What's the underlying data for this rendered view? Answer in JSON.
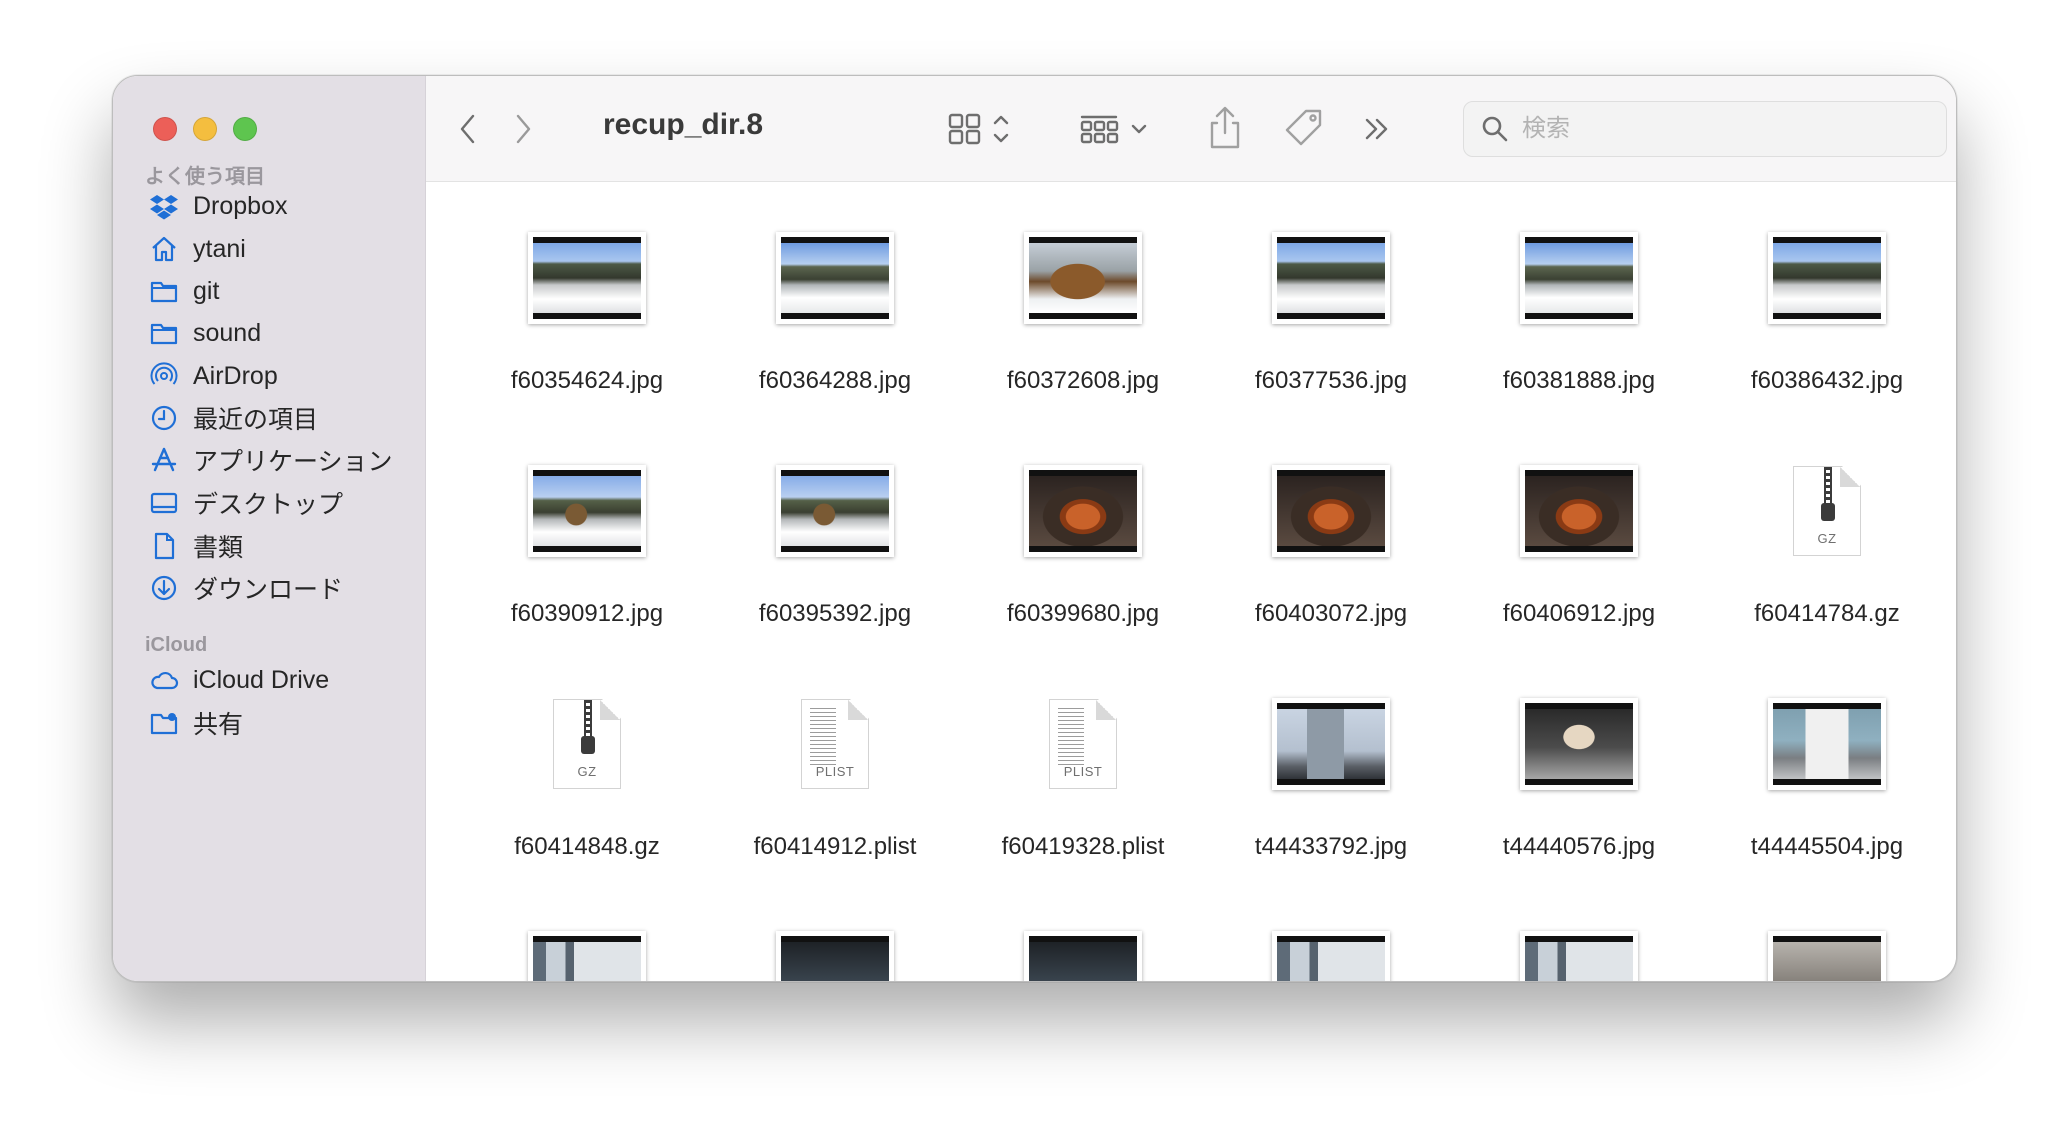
{
  "window": {
    "title": "recup_dir.8",
    "traffic_lights": {
      "close": "#ec5f58",
      "minimize": "#f4be3f",
      "zoom": "#5ec54f"
    }
  },
  "sidebar": {
    "favorites_heading": "よく使う項目",
    "favorites": [
      {
        "label": "Dropbox",
        "icon": "dropbox-icon"
      },
      {
        "label": "ytani",
        "icon": "home-icon"
      },
      {
        "label": "git",
        "icon": "folder-icon"
      },
      {
        "label": "sound",
        "icon": "folder-icon"
      },
      {
        "label": "AirDrop",
        "icon": "airdrop-icon"
      },
      {
        "label": "最近の項目",
        "icon": "clock-icon"
      },
      {
        "label": "アプリケーション",
        "icon": "applications-icon"
      },
      {
        "label": "デスクトップ",
        "icon": "desktop-icon"
      },
      {
        "label": "書類",
        "icon": "document-icon"
      },
      {
        "label": "ダウンロード",
        "icon": "download-icon"
      }
    ],
    "icloud_heading": "iCloud",
    "icloud": [
      {
        "label": "iCloud Drive",
        "icon": "cloud-icon"
      },
      {
        "label": "共有",
        "icon": "shared-folder-icon"
      }
    ]
  },
  "toolbar": {
    "back": "chevron-left-icon",
    "forward": "chevron-right-icon",
    "view_mode": "icon-grid-icon",
    "group_by": "group-icon",
    "share": "share-icon",
    "tags": "tag-icon",
    "more": "double-chevron-icon",
    "search_placeholder": "検索"
  },
  "files": [
    {
      "name": "f60354624.jpg",
      "type": "image",
      "preview": "rail"
    },
    {
      "name": "f60364288.jpg",
      "type": "image",
      "preview": "rail2"
    },
    {
      "name": "f60372608.jpg",
      "type": "image",
      "preview": "cabin"
    },
    {
      "name": "f60377536.jpg",
      "type": "image",
      "preview": "rail"
    },
    {
      "name": "f60381888.jpg",
      "type": "image",
      "preview": "rail2"
    },
    {
      "name": "f60386432.jpg",
      "type": "image",
      "preview": "rail"
    },
    {
      "name": "f60390912.jpg",
      "type": "image",
      "preview": "train"
    },
    {
      "name": "f60395392.jpg",
      "type": "image",
      "preview": "train"
    },
    {
      "name": "f60399680.jpg",
      "type": "image",
      "preview": "food"
    },
    {
      "name": "f60403072.jpg",
      "type": "image",
      "preview": "food"
    },
    {
      "name": "f60406912.jpg",
      "type": "image",
      "preview": "food"
    },
    {
      "name": "f60414784.gz",
      "type": "gz",
      "label": "GZ"
    },
    {
      "name": "f60414848.gz",
      "type": "gz",
      "label": "GZ"
    },
    {
      "name": "f60414912.plist",
      "type": "plist",
      "label": "PLIST"
    },
    {
      "name": "f60419328.plist",
      "type": "plist",
      "label": "PLIST"
    },
    {
      "name": "t44433792.jpg",
      "type": "image",
      "preview": "building"
    },
    {
      "name": "t44440576.jpg",
      "type": "image",
      "preview": "hall"
    },
    {
      "name": "t44445504.jpg",
      "type": "image",
      "preview": "bus"
    },
    {
      "name": "",
      "type": "image",
      "preview": "city"
    },
    {
      "name": "",
      "type": "image",
      "preview": "dark"
    },
    {
      "name": "",
      "type": "image",
      "preview": "dark"
    },
    {
      "name": "",
      "type": "image",
      "preview": "city"
    },
    {
      "name": "",
      "type": "image",
      "preview": "city"
    },
    {
      "name": "",
      "type": "image",
      "preview": "lot"
    }
  ]
}
